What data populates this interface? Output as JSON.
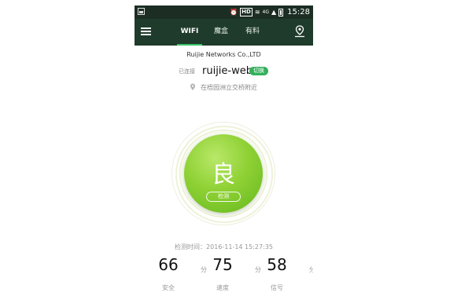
{
  "statusbar": {
    "hd": "HD",
    "network": "4G",
    "time": "15:28"
  },
  "navbar": {
    "tabs": [
      {
        "label": "WIFI",
        "active": true
      },
      {
        "label": "魔盒",
        "active": false
      },
      {
        "label": "有料",
        "active": false
      }
    ]
  },
  "network": {
    "company": "Ruijie Networks Co.,LTD",
    "connected_label": "已连接",
    "ssid": "ruijie-web",
    "switch_label": "切换",
    "location": "在梧园洲立交桥附近"
  },
  "gauge": {
    "grade": "良",
    "check_label": "检测"
  },
  "check_time": "检测时间：2016-11-14 15:27:35",
  "scores": [
    {
      "value": "66",
      "unit": "分",
      "name": "安全"
    },
    {
      "value": "75",
      "unit": "分",
      "name": "速度"
    },
    {
      "value": "58",
      "unit": "分",
      "name": "信号"
    }
  ],
  "colors": {
    "statusbar_bg": "#1c2e24",
    "navbar_bg": "#1f3b2b",
    "accent": "#34b05c",
    "gauge_green": "#8fd135"
  }
}
